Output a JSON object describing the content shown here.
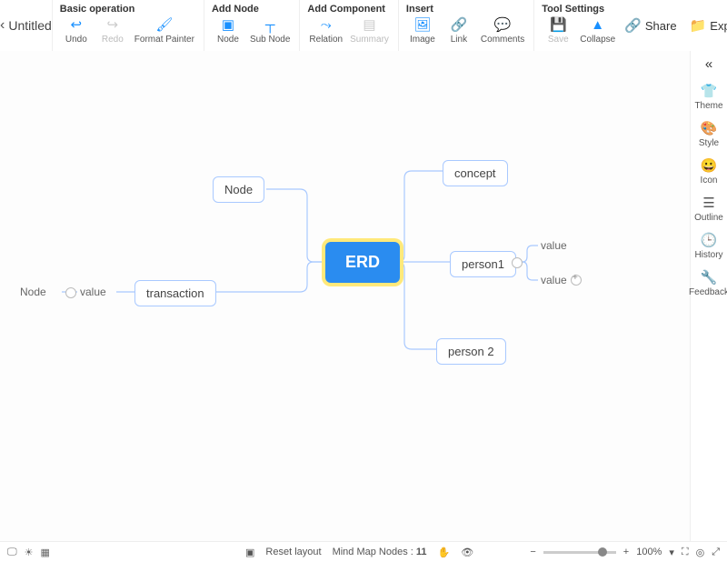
{
  "header": {
    "title": "Untitled",
    "groups": {
      "basic": {
        "title": "Basic operation",
        "undo": "Undo",
        "redo": "Redo",
        "format": "Format Painter"
      },
      "addnode": {
        "title": "Add Node",
        "node": "Node",
        "subnode": "Sub Node"
      },
      "addcomp": {
        "title": "Add Component",
        "relation": "Relation",
        "summary": "Summary"
      },
      "insert": {
        "title": "Insert",
        "image": "Image",
        "link": "Link",
        "comments": "Comments"
      },
      "tool": {
        "title": "Tool Settings",
        "save": "Save",
        "collapse": "Collapse"
      }
    },
    "share": "Share",
    "export": "Export"
  },
  "sidebar": {
    "theme": "Theme",
    "style": "Style",
    "icon": "Icon",
    "outline": "Outline",
    "history": "History",
    "feedback": "Feedback"
  },
  "nodes": {
    "root": "ERD",
    "node_top": "Node",
    "transaction": "transaction",
    "left_node": "Node",
    "left_value": "value",
    "concept": "concept",
    "person1": "person1",
    "person2": "person 2",
    "val1": "value",
    "val2": "value"
  },
  "status": {
    "reset": "Reset layout",
    "count_label": "Mind Map Nodes :",
    "count": "11",
    "zoom": "100%"
  }
}
